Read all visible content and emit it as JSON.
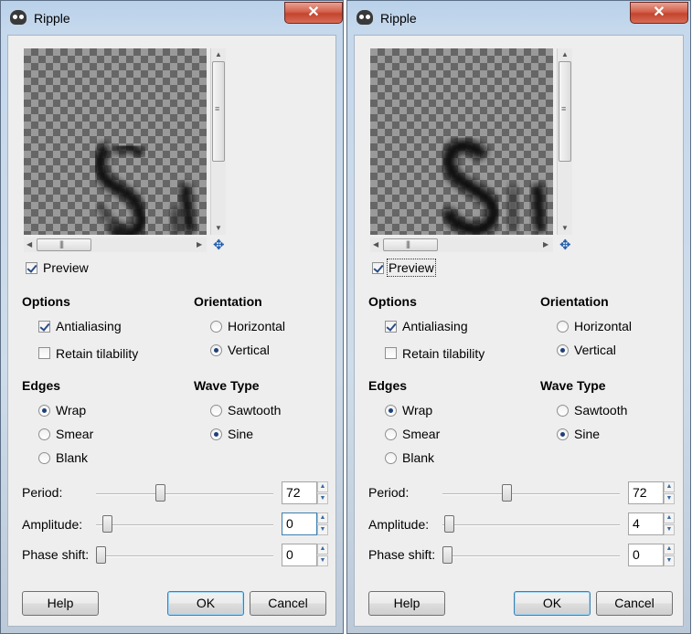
{
  "dialogs": [
    {
      "title": "Ripple",
      "close_glyph": "✕",
      "preview_label": "Preview",
      "preview_checked": true,
      "options": {
        "heading": "Options",
        "antialiasing_label": "Antialiasing",
        "antialiasing_checked": true,
        "retain_tilability_label": "Retain tilability",
        "retain_tilability_checked": false
      },
      "orientation": {
        "heading": "Orientation",
        "horizontal_label": "Horizontal",
        "vertical_label": "Vertical",
        "selected": "Vertical"
      },
      "edges": {
        "heading": "Edges",
        "wrap_label": "Wrap",
        "smear_label": "Smear",
        "blank_label": "Blank",
        "selected": "Wrap"
      },
      "wave_type": {
        "heading": "Wave Type",
        "sawtooth_label": "Sawtooth",
        "sine_label": "Sine",
        "selected": "Sine"
      },
      "period": {
        "label": "Period:",
        "value": "72"
      },
      "amplitude": {
        "label": "Amplitude:",
        "value": "0"
      },
      "phase_shift": {
        "label": "Phase shift:",
        "value": "0"
      },
      "buttons": {
        "help": "Help",
        "ok": "OK",
        "cancel": "Cancel"
      }
    },
    {
      "title": "Ripple",
      "close_glyph": "✕",
      "preview_label": "Preview",
      "preview_checked": true,
      "options": {
        "heading": "Options",
        "antialiasing_label": "Antialiasing",
        "antialiasing_checked": true,
        "retain_tilability_label": "Retain tilability",
        "retain_tilability_checked": false
      },
      "orientation": {
        "heading": "Orientation",
        "horizontal_label": "Horizontal",
        "vertical_label": "Vertical",
        "selected": "Vertical"
      },
      "edges": {
        "heading": "Edges",
        "wrap_label": "Wrap",
        "smear_label": "Smear",
        "blank_label": "Blank",
        "selected": "Wrap"
      },
      "wave_type": {
        "heading": "Wave Type",
        "sawtooth_label": "Sawtooth",
        "sine_label": "Sine",
        "selected": "Sine"
      },
      "period": {
        "label": "Period:",
        "value": "72"
      },
      "amplitude": {
        "label": "Amplitude:",
        "value": "4"
      },
      "phase_shift": {
        "label": "Phase shift:",
        "value": "0"
      },
      "buttons": {
        "help": "Help",
        "ok": "OK",
        "cancel": "Cancel"
      }
    }
  ]
}
